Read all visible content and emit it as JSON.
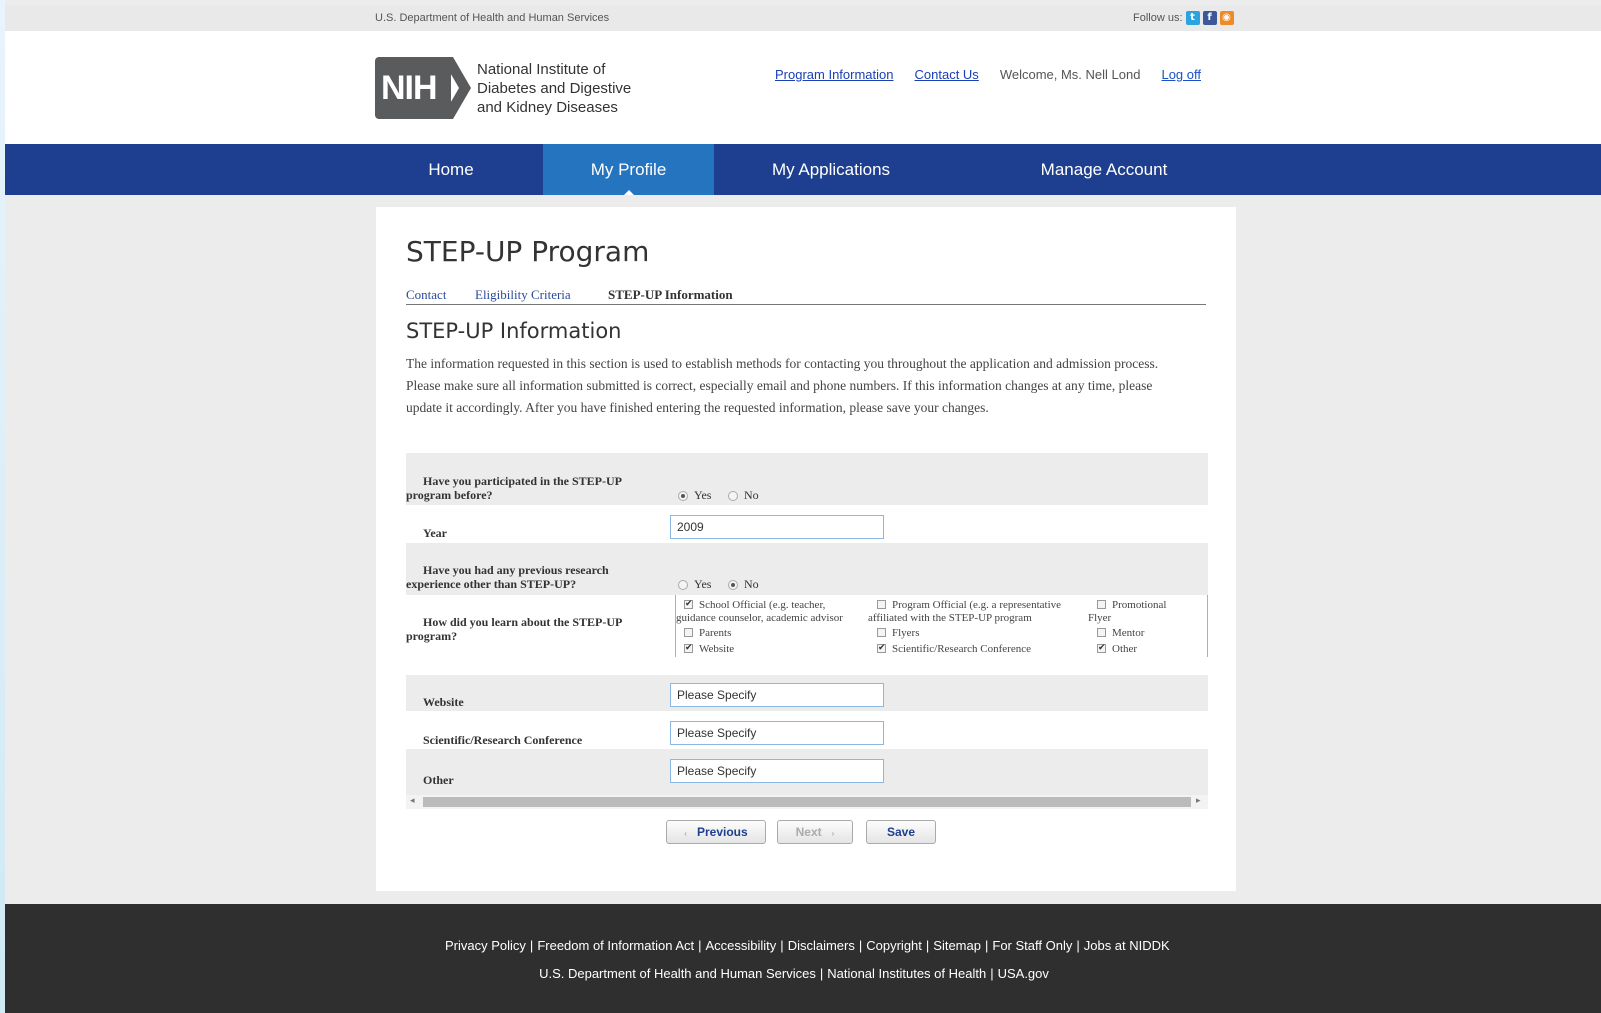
{
  "top": {
    "dept": "U.S. Department of Health and Human Services",
    "follow": "Follow us:",
    "social": [
      {
        "icon": "twitter-icon",
        "glyph": "t",
        "color": "#2aa3e0"
      },
      {
        "icon": "facebook-icon",
        "glyph": "f",
        "color": "#3b5998"
      },
      {
        "icon": "rss-icon",
        "glyph": "◉",
        "color": "#f08a24"
      }
    ]
  },
  "header": {
    "logo_text": "NIH",
    "org_line1": "National Institute of",
    "org_line2": "Diabetes and Digestive",
    "org_line3": "and Kidney Diseases",
    "link_program": "Program Information",
    "link_contact": "Contact Us",
    "welcome": "Welcome, Ms. Nell Lond",
    "link_logoff": "Log off"
  },
  "nav": {
    "home": "Home",
    "profile": "My Profile",
    "applications": "My Applications",
    "manage": "Manage Account",
    "active": "My Profile"
  },
  "page": {
    "title": "STEP-UP Program",
    "tabs": [
      "Contact",
      "Eligibility Criteria",
      "STEP-UP Information"
    ],
    "section_title": "STEP-UP Information",
    "description": "The information requested in this section is used to establish methods for contacting you throughout the application and admission process. Please make sure all information submitted is correct, especially email and phone numbers. If this information changes at any time, please update it accordingly. After you have finished entering the requested information, please save your changes."
  },
  "form": {
    "q1": {
      "l1": "Have you participated in the STEP-UP",
      "l2": "program before?",
      "yes": "Yes",
      "no": "No",
      "selected": "Yes"
    },
    "year": {
      "label": "Year",
      "value": "2009"
    },
    "q2": {
      "l1": "Have you had any previous research",
      "l2": "experience other than STEP-UP?",
      "yes": "Yes",
      "no": "No",
      "selected": "No"
    },
    "q3": {
      "l1": "How did you learn about the STEP-UP",
      "l2": "program?",
      "options": {
        "school_l1": "School Official (e.g. teacher,",
        "school_l2": "guidance counselor, academic advisor",
        "program_l1": "Program Official (e.g. a representative",
        "program_l2": "affiliated with the STEP-UP program",
        "promo_l1": "Promotional",
        "promo_l2": "Flyer",
        "parents": "Parents",
        "flyers": "Flyers",
        "mentor": "Mentor",
        "website": "Website",
        "conference": "Scientific/Research Conference",
        "other": "Other"
      }
    },
    "website": {
      "label": "Website",
      "value": "Please Specify"
    },
    "conference": {
      "label": "Scientific/Research Conference",
      "value": "Please Specify"
    },
    "other": {
      "label": "Other",
      "value": "Please Specify"
    }
  },
  "buttons": {
    "previous": "Previous",
    "next": "Next",
    "save": "Save"
  },
  "footer": {
    "links1": [
      "Privacy Policy",
      "Freedom of Information Act",
      "Accessibility",
      "Disclaimers",
      "Copyright",
      "Sitemap",
      "For Staff Only",
      "Jobs at NIDDK"
    ],
    "links2": [
      "U.S. Department of Health and Human Services",
      "National Institutes of Health",
      "USA.gov"
    ]
  }
}
